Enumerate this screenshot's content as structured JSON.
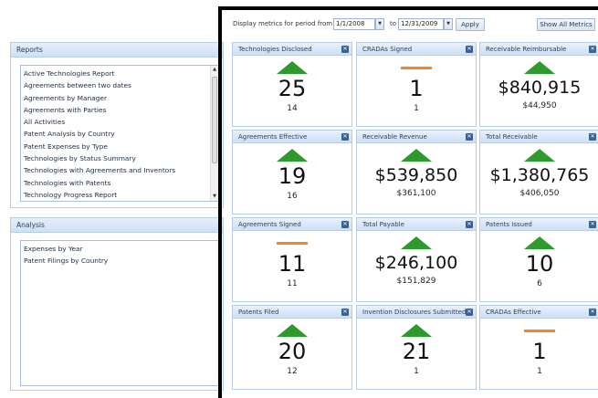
{
  "reports": {
    "title": "Reports",
    "items": [
      "Active Technologies Report",
      "Agreements between two dates",
      "Agreements by Manager",
      "Agreements with Parties",
      "All Activities",
      "Patent Analysis by Country",
      "Patent Expenses by Type",
      "Technologies by Status Summary",
      "Technologies with Agreements and Inventors",
      "Technologies with Patents",
      "Technology Progress Report"
    ]
  },
  "analysis": {
    "title": "Analysis",
    "items": [
      "Expenses by Year",
      "Patent Filings by Country"
    ]
  },
  "topbar": {
    "period_label": "Display metrics for period from",
    "from_date": "1/1/2008",
    "to_label": "to",
    "to_date": "12/31/2009",
    "apply_label": "Apply",
    "show_all_label": "Show All Metrics"
  },
  "tiles": [
    {
      "title": "Technologies Disclosed",
      "trend": "up",
      "value": "25",
      "previous": "14"
    },
    {
      "title": "CRADAs Signed",
      "trend": "flat",
      "value": "1",
      "previous": "1"
    },
    {
      "title": "Receivable Reimbursable",
      "trend": "up",
      "value": "$840,915",
      "previous": "$44,950"
    },
    {
      "title": "Agreements Effective",
      "trend": "up",
      "value": "19",
      "previous": "16"
    },
    {
      "title": "Receivable Revenue",
      "trend": "up",
      "value": "$539,850",
      "previous": "$361,100"
    },
    {
      "title": "Total Receivable",
      "trend": "up",
      "value": "$1,380,765",
      "previous": "$406,050"
    },
    {
      "title": "Agreements Signed",
      "trend": "flat",
      "value": "11",
      "previous": "11"
    },
    {
      "title": "Total Payable",
      "trend": "up",
      "value": "$246,100",
      "previous": "$151,829"
    },
    {
      "title": "Patents Issued",
      "trend": "up",
      "value": "10",
      "previous": "6"
    },
    {
      "title": "Patents Filed",
      "trend": "up",
      "value": "20",
      "previous": "12"
    },
    {
      "title": "Invention Disclosures Submitted",
      "trend": "up",
      "value": "21",
      "previous": "1"
    },
    {
      "title": "CRADAs Effective",
      "trend": "flat",
      "value": "1",
      "previous": "1"
    }
  ],
  "colors": {
    "trend_up": "#2e9a2e",
    "trend_flat": "#f0872b",
    "header_bg": "#cddff4",
    "close_icon": "#3b5f9a"
  }
}
